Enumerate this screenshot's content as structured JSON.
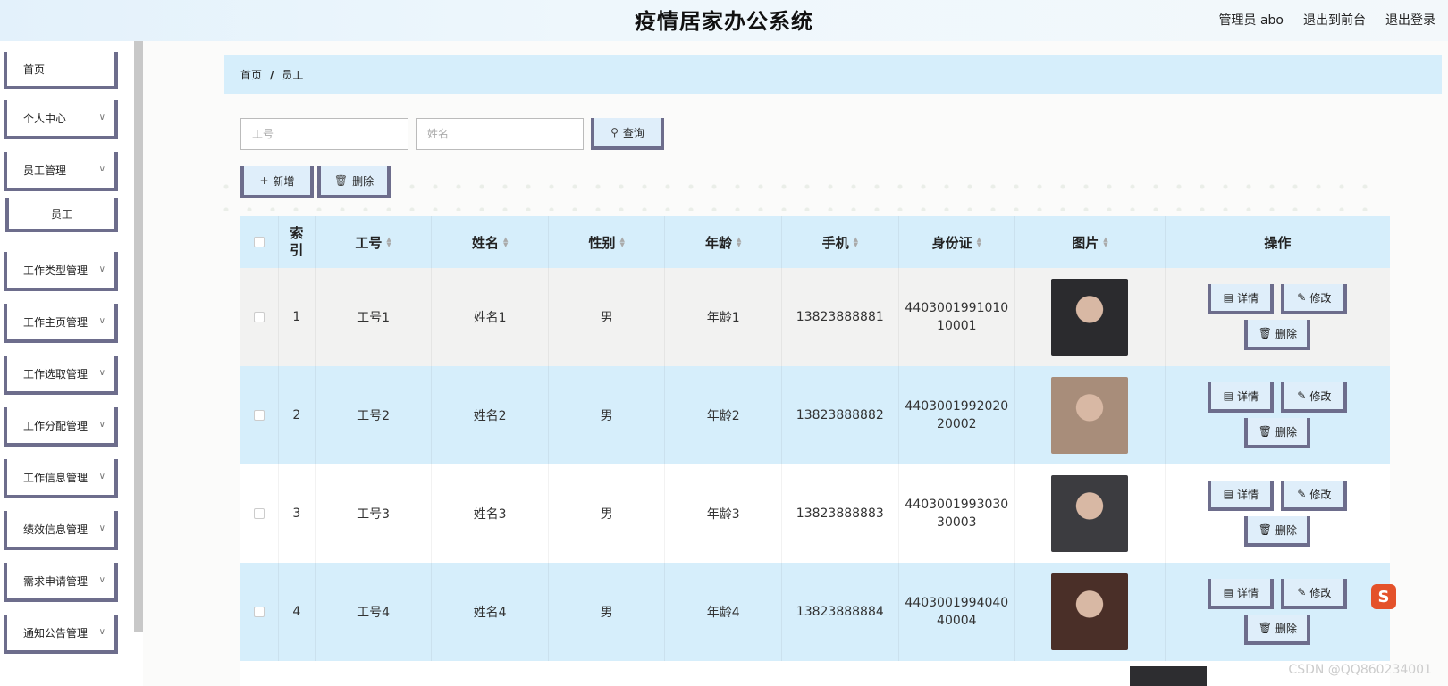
{
  "header": {
    "title": "疫情居家办公系统",
    "user": "管理员 abo",
    "front_link": "退出到前台",
    "logout": "退出登录"
  },
  "sidebar": {
    "items": [
      {
        "label": "首页",
        "has_arrow": false
      },
      {
        "label": "个人中心",
        "has_arrow": true
      },
      {
        "label": "员工管理",
        "has_arrow": true
      },
      {
        "label": "员工",
        "sub": true
      },
      {
        "label": "工作类型管理",
        "has_arrow": true
      },
      {
        "label": "工作主页管理",
        "has_arrow": true
      },
      {
        "label": "工作选取管理",
        "has_arrow": true
      },
      {
        "label": "工作分配管理",
        "has_arrow": true
      },
      {
        "label": "工作信息管理",
        "has_arrow": true
      },
      {
        "label": "绩效信息管理",
        "has_arrow": true
      },
      {
        "label": "需求申请管理",
        "has_arrow": true
      },
      {
        "label": "通知公告管理",
        "has_arrow": true
      }
    ]
  },
  "breadcrumb": {
    "home": "首页",
    "sep": "/",
    "current": "员工"
  },
  "search": {
    "gonghao_placeholder": "工号",
    "name_placeholder": "姓名",
    "query_label": "查询"
  },
  "toolbar": {
    "add_label": "新增",
    "delete_label": "删除"
  },
  "table": {
    "headers": {
      "index": "索引",
      "gonghao": "工号",
      "name": "姓名",
      "gender": "性别",
      "age": "年龄",
      "phone": "手机",
      "idcard": "身份证",
      "photo": "图片",
      "actions": "操作"
    },
    "rows": [
      {
        "index": "1",
        "gonghao": "工号1",
        "name": "姓名1",
        "gender": "男",
        "age": "年龄1",
        "phone": "13823888881",
        "idcard": "440300199101010001",
        "photo_color": "#2b2b2e"
      },
      {
        "index": "2",
        "gonghao": "工号2",
        "name": "姓名2",
        "gender": "男",
        "age": "年龄2",
        "phone": "13823888882",
        "idcard": "440300199202020002",
        "photo_color": "#a88d7a"
      },
      {
        "index": "3",
        "gonghao": "工号3",
        "name": "姓名3",
        "gender": "男",
        "age": "年龄3",
        "phone": "13823888883",
        "idcard": "440300199303030003",
        "photo_color": "#3c3c40"
      },
      {
        "index": "4",
        "gonghao": "工号4",
        "name": "姓名4",
        "gender": "男",
        "age": "年龄4",
        "phone": "13823888884",
        "idcard": "440300199404040004",
        "photo_color": "#4a2f28"
      }
    ],
    "action_labels": {
      "detail": "详情",
      "edit": "修改",
      "delete": "删除"
    }
  },
  "watermark": "CSDN @QQ860234001",
  "colors": {
    "accent_border": "#6d6d8c",
    "light_blue": "#d6eefb"
  }
}
